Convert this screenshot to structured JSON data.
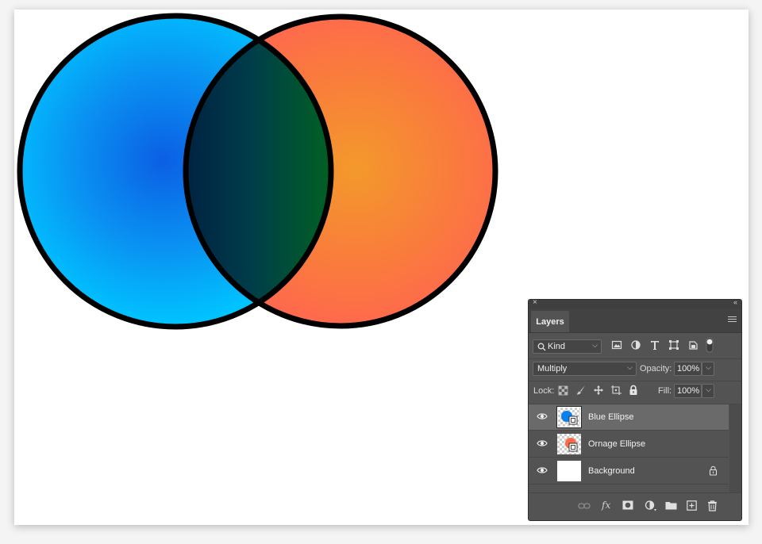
{
  "panel": {
    "close_glyph": "×",
    "collapse_glyph": "‹‹",
    "tab_label": "Layers",
    "filter": {
      "kind_label": "Kind",
      "icons": [
        "image-filter-icon",
        "adjustment-filter-icon",
        "type-filter-icon",
        "shape-filter-icon",
        "smart-object-filter-icon",
        "filter-toggle-icon"
      ]
    },
    "blend": {
      "mode": "Multiply",
      "opacity_label": "Opacity:",
      "opacity_value": "100%"
    },
    "lock": {
      "label": "Lock:",
      "fill_label": "Fill:",
      "fill_value": "100%"
    },
    "layers": [
      {
        "name": "Blue Ellipse",
        "selected": true,
        "thumb": "blue-ellipse"
      },
      {
        "name": "Ornage Ellipse",
        "selected": false,
        "thumb": "orange-ellipse"
      },
      {
        "name": "Background",
        "selected": false,
        "thumb": "white",
        "locked": true
      }
    ],
    "bottom_icons": [
      "link-icon",
      "fx-icon",
      "mask-icon",
      "adjustment-layer-icon",
      "folder-icon",
      "new-layer-icon",
      "trash-icon"
    ],
    "fx_label": "fx"
  },
  "colors": {
    "blue_center": "#0b62e6",
    "blue_edge": "#00bfff",
    "orange_center": "#f29a2a",
    "orange_edge": "#ff6650",
    "overlap_dark": "#002244",
    "overlap_green": "#005f1f",
    "panel_bg": "#535353",
    "selected_row": "#6a6a6a"
  }
}
